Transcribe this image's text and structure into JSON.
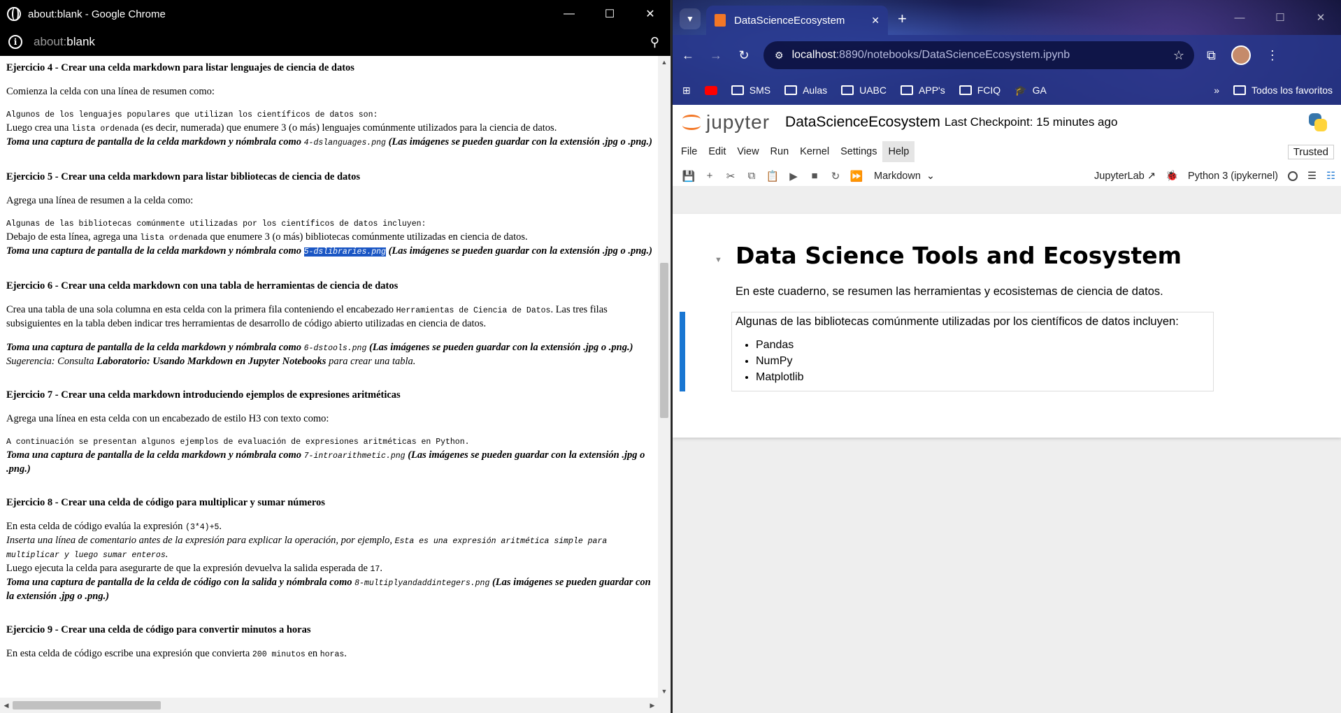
{
  "left_window": {
    "title": "about:blank - Google Chrome",
    "url_scheme": "about:",
    "url_rest": "blank"
  },
  "doc": {
    "ex4": {
      "heading": "Ejercicio 4 - Crear una celda markdown para listar lenguajes de ciencia de datos",
      "intro": "Comienza la celda con una línea de resumen como:",
      "code": "Algunos de los lenguajes populares que utilizan los científicos de datos son:",
      "line1a": "Luego crea una ",
      "line1code": "lista ordenada",
      "line1b": " (es decir, numerada) que enumere 3 (o más) lenguajes comúnmente utilizados para la ciencia de datos.",
      "shot_a": "Toma una captura de pantalla de la celda markdown y nómbrala como ",
      "shot_file": "4-dslanguages.png",
      "shot_b": " (Las imágenes se pueden guardar con la extensión .jpg o .png.)"
    },
    "ex5": {
      "heading": "Ejercicio 5 - Crear una celda markdown para listar bibliotecas de ciencia de datos",
      "intro": "Agrega una línea de resumen a la celda como:",
      "code": "Algunas de las bibliotecas comúnmente utilizadas por los científicos de datos incluyen:",
      "line1a": "Debajo de esta línea, agrega una ",
      "line1code": "lista ordenada",
      "line1b": " que enumere 3 (o más) bibliotecas comúnmente utilizadas en ciencia de datos.",
      "shot_a": "Toma una captura de pantalla de la celda markdown y nómbrala como ",
      "shot_file": "5-dslibraries.png",
      "shot_b": " (Las imágenes se pueden guardar con la extensión .jpg o .png.)"
    },
    "ex6": {
      "heading": "Ejercicio 6 - Crear una celda markdown con una tabla de herramientas de ciencia de datos",
      "p1a": "Crea una tabla de una sola columna en esta celda con la primera fila conteniendo el encabezado ",
      "p1code": "Herramientas de Ciencia de Datos",
      "p1b": ". Las tres filas subsiguientes en la tabla deben indicar tres herramientas de desarrollo de código abierto utilizadas en ciencia de datos.",
      "shot_a": "Toma una captura de pantalla de la celda markdown y nómbrala como ",
      "shot_file": "6-dstools.png",
      "shot_b": " (Las imágenes se pueden guardar con la extensión .jpg o .png.)",
      "hint_a": "Sugerencia: Consulta ",
      "hint_bold": "Laboratorio: Usando Markdown en Jupyter Notebooks",
      "hint_b": " para crear una tabla."
    },
    "ex7": {
      "heading": "Ejercicio 7 - Crear una celda markdown introduciendo ejemplos de expresiones aritméticas",
      "intro": "Agrega una línea en esta celda con un encabezado de estilo H3 con texto como:",
      "code": "A continuación se presentan algunos ejemplos de evaluación de expresiones aritméticas en Python.",
      "shot_a": "Toma una captura de pantalla de la celda markdown y nómbrala como ",
      "shot_file": "7-introarithmetic.png",
      "shot_b": " (Las imágenes se pueden guardar con la extensión .jpg o .png.)"
    },
    "ex8": {
      "heading": "Ejercicio 8 - Crear una celda de código para multiplicar y sumar números",
      "p1a": "En esta celda de código evalúa la expresión ",
      "p1code": "(3*4)+5",
      "p1b": ".",
      "p2a": "Inserta una línea de comentario antes de la expresión para explicar la operación, por ejemplo, ",
      "p2code": "Esta es una expresión aritmética simple para multiplicar y luego sumar enteros",
      "p2b": ".",
      "p3a": "Luego ejecuta la celda para asegurarte de que la expresión devuelva la salida esperada de ",
      "p3code": "17",
      "p3b": ".",
      "shot_a": "Toma una captura de pantalla de la celda de código con la salida y nómbrala como ",
      "shot_file": "8-multiplyandaddintegers.png",
      "shot_b": " (Las imágenes se pueden guardar con la extensión .jpg o .png.)"
    },
    "ex9": {
      "heading": "Ejercicio 9 - Crear una celda de código para convertir minutos a horas",
      "p1a": "En esta celda de código escribe una expresión que convierta ",
      "p1code": "200 minutos",
      "p1b": " en ",
      "p1code2": "horas",
      "p1c": "."
    }
  },
  "right_window": {
    "tab_title": "DataScienceEcosystem",
    "url_host": "localhost",
    "url_path": ":8890/notebooks/DataScienceEcosystem.ipynb",
    "bookmarks": [
      "SMS",
      "Aulas",
      "UABC",
      "APP's",
      "FCIQ",
      "GA"
    ],
    "all_bookmarks": "Todos los favoritos",
    "jupyter": {
      "logo_text": "jupyter",
      "notebook_title": "DataScienceEcosystem",
      "checkpoint": "Last Checkpoint: 15 minutes ago",
      "menu": [
        "File",
        "Edit",
        "View",
        "Run",
        "Kernel",
        "Settings",
        "Help"
      ],
      "trusted": "Trusted",
      "cell_type": "Markdown",
      "jupyterlab": "JupyterLab",
      "kernel": "Python 3 (ipykernel)"
    },
    "notebook": {
      "h1": "Data Science Tools and Ecosystem",
      "intro": "En este cuaderno, se resumen las herramientas y ecosistemas de ciencia de datos.",
      "cell_lead": "Algunas de las bibliotecas comúnmente utilizadas por los científicos de datos incluyen:",
      "libraries": [
        "Pandas",
        "NumPy",
        "Matplotlib"
      ]
    }
  }
}
